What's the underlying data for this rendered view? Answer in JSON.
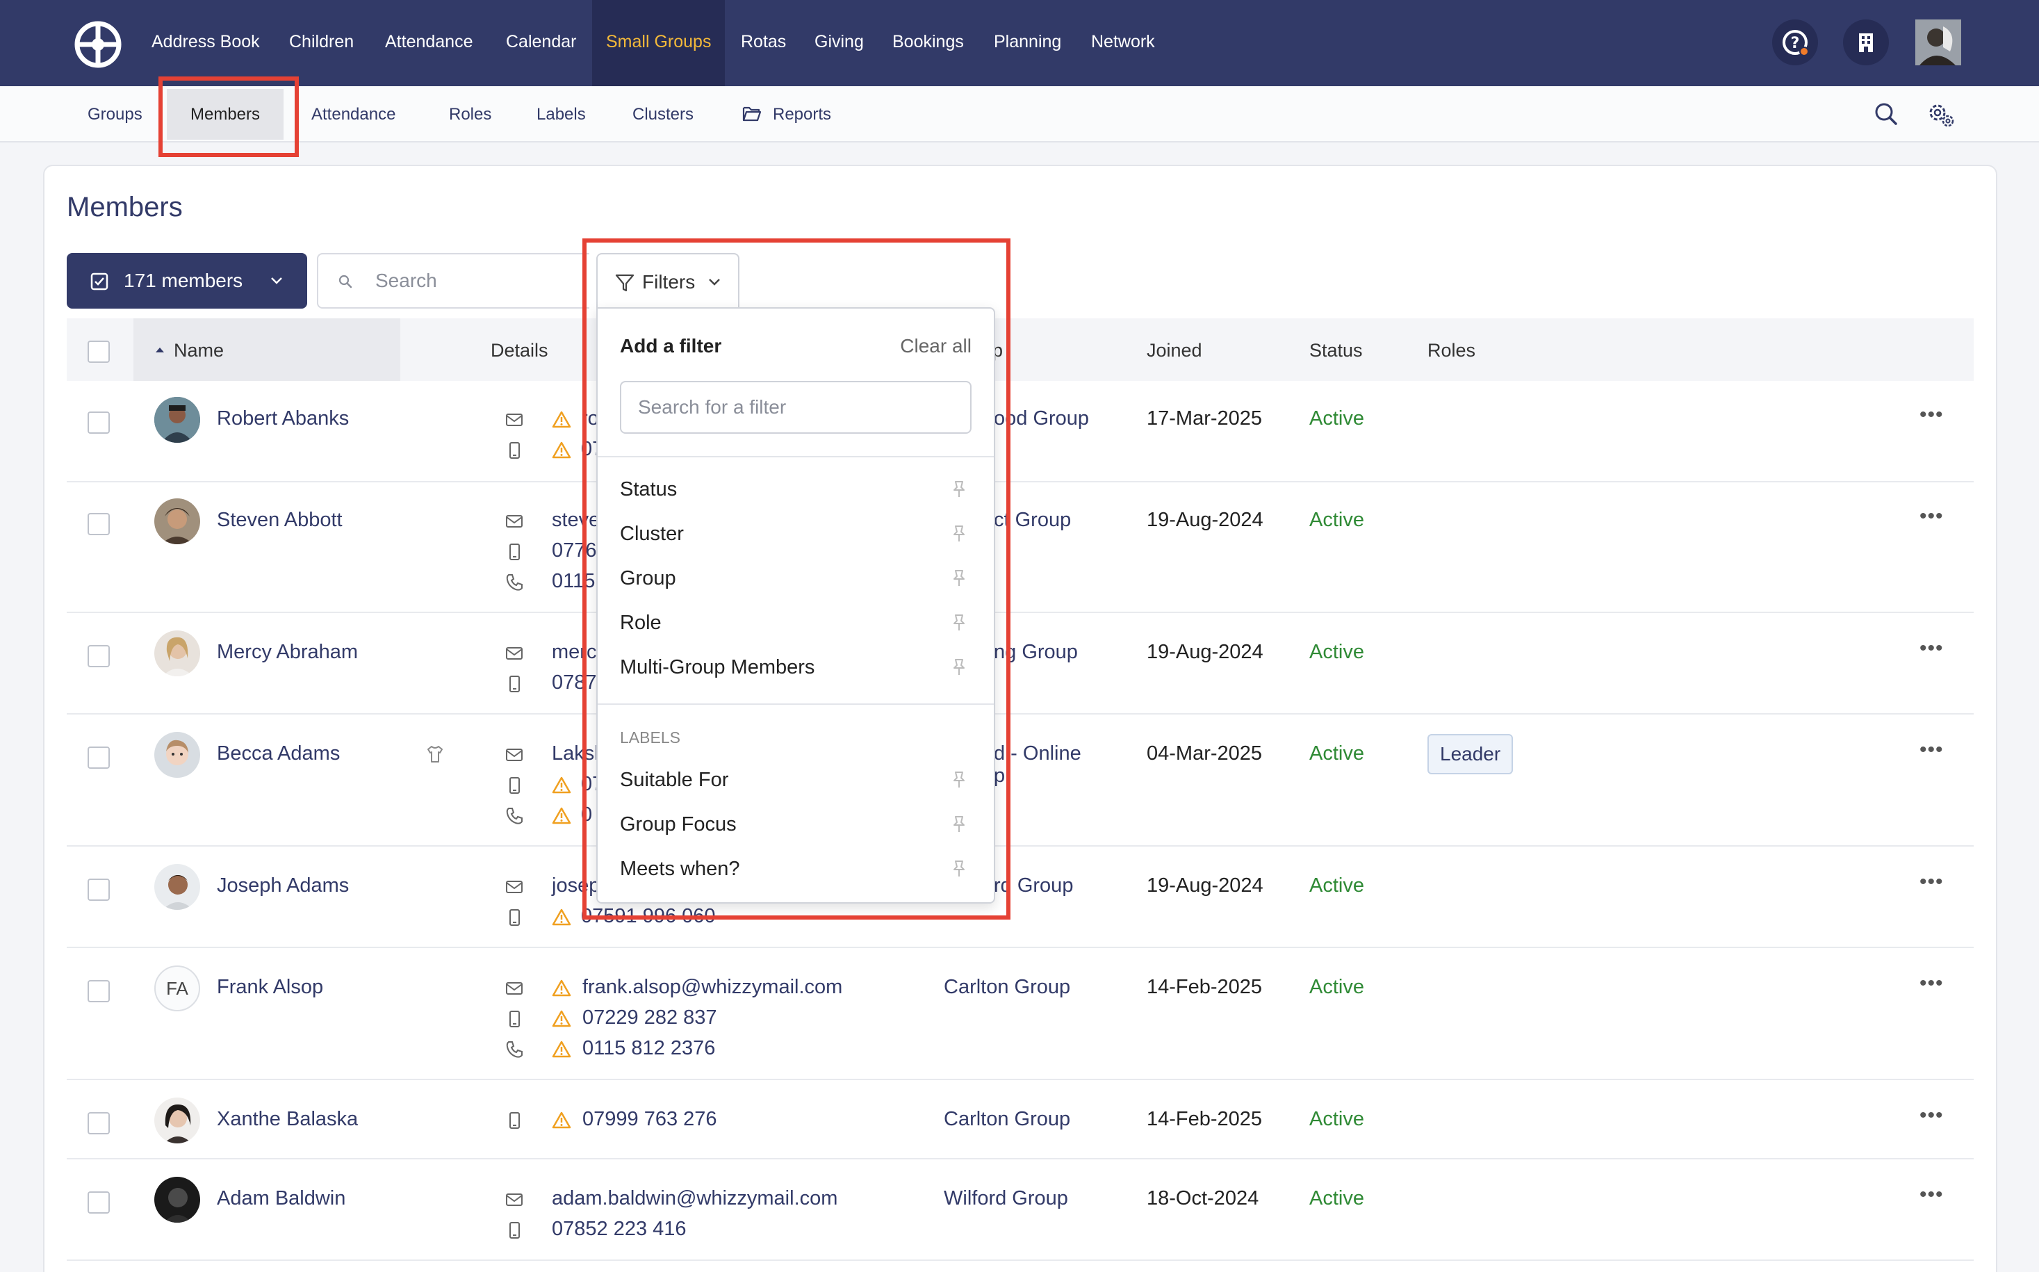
{
  "topnav": {
    "items": [
      "Address Book",
      "Children",
      "Attendance",
      "Calendar",
      "Small Groups",
      "Rotas",
      "Giving",
      "Bookings",
      "Planning",
      "Network"
    ],
    "active": "Small Groups"
  },
  "subnav": {
    "items": [
      "Groups",
      "Members",
      "Attendance",
      "Roles",
      "Labels",
      "Clusters",
      "Reports"
    ],
    "active": "Members"
  },
  "page": {
    "title": "Members"
  },
  "toolbar": {
    "members_label": "171 members",
    "search_placeholder": "Search",
    "filters_label": "Filters"
  },
  "table": {
    "headers": {
      "name": "Name",
      "details": "Details",
      "group": "Group",
      "joined": "Joined",
      "status": "Status",
      "roles": "Roles"
    },
    "rows": [
      {
        "name": "Robert Abanks",
        "details": [
          "ro",
          "07"
        ],
        "group": "Wollaton Wood Group",
        "group_visible": "ood Group",
        "joined": "17-Mar-2025",
        "status": "Active",
        "role": ""
      },
      {
        "name": "Steven Abbott",
        "details": [
          "steve",
          "0776",
          "0115"
        ],
        "group_visible": "ct Group",
        "joined": "19-Aug-2024",
        "status": "Active",
        "role": ""
      },
      {
        "name": "Mercy Abraham",
        "details": [
          "merc",
          "0787"
        ],
        "group_visible": "ng Group",
        "joined": "19-Aug-2024",
        "status": "Active",
        "role": ""
      },
      {
        "name": "Becca Adams",
        "details": [
          "Laksl",
          "07",
          "0"
        ],
        "group_visible": "d - Online",
        "group_line2": "p",
        "joined": "04-Mar-2025",
        "status": "Active",
        "role": "Leader"
      },
      {
        "name": "Joseph Adams",
        "details": [
          "josep",
          "07591 996 060"
        ],
        "group_visible": "rd Group",
        "joined": "19-Aug-2024",
        "status": "Active",
        "role": ""
      },
      {
        "name": "Frank Alsop",
        "initials": "FA",
        "details": [
          "frank.alsop@whizzymail.com",
          "07229 282 837",
          "0115 812 2376"
        ],
        "group_visible": "Carlton Group",
        "joined": "14-Feb-2025",
        "status": "Active",
        "role": ""
      },
      {
        "name": "Xanthe Balaska",
        "details": [
          "07999 763 276"
        ],
        "group_visible": "Carlton Group",
        "joined": "14-Feb-2025",
        "status": "Active",
        "role": ""
      },
      {
        "name": "Adam Baldwin",
        "details": [
          "adam.baldwin@whizzymail.com",
          "07852 223 416"
        ],
        "group_visible": "Wilford Group",
        "joined": "18-Oct-2024",
        "status": "Active",
        "role": ""
      }
    ]
  },
  "filter_dropdown": {
    "title": "Add a filter",
    "clear_all": "Clear all",
    "search_placeholder": "Search for a filter",
    "items": [
      "Status",
      "Cluster",
      "Group",
      "Role",
      "Multi-Group Members"
    ],
    "section_label": "LABELS",
    "label_items": [
      "Suitable For",
      "Group Focus",
      "Meets when?"
    ]
  },
  "colors": {
    "navy": "#323a68",
    "active_nav": "#f3b93a",
    "highlight": "#e54134",
    "status_active": "#2f8a35",
    "warning": "#f0a020"
  }
}
